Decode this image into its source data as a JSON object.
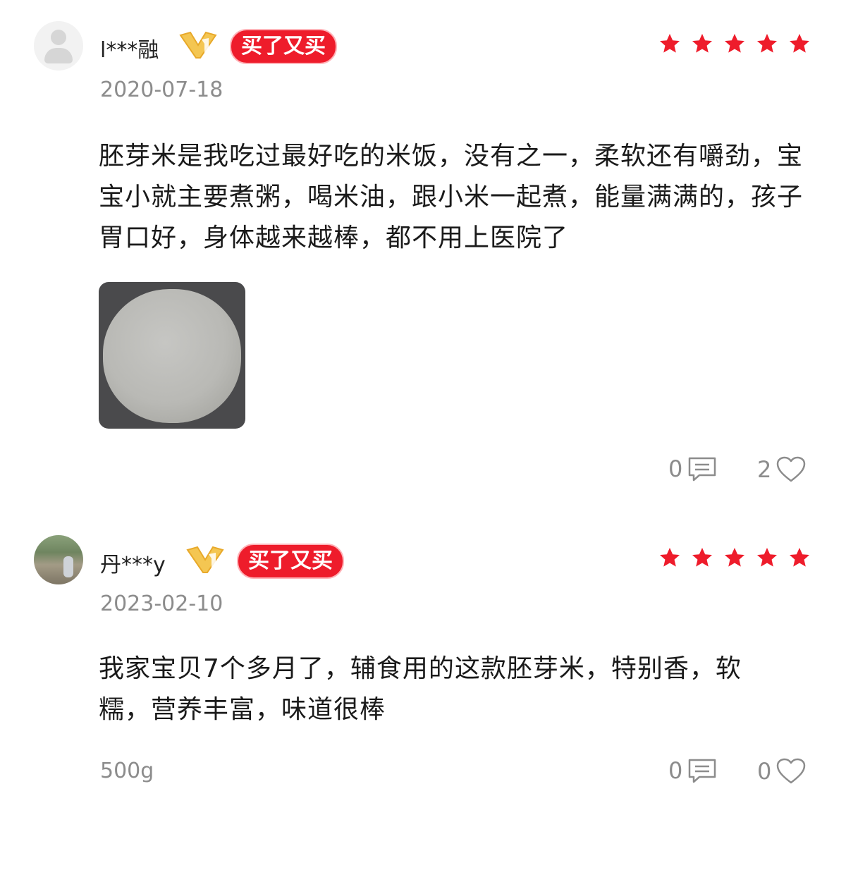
{
  "reviews": [
    {
      "username": "l***融",
      "badge": "买了又买",
      "stars": 5,
      "date": "2020-07-18",
      "text": "胚芽米是我吃过最好吃的米饭，没有之一，柔软还有嚼劲，宝宝小就主要煮粥，喝米油，跟小米一起煮，能量满满的，孩子胃口好，身体越来越棒，都不用上医院了",
      "has_photo": true,
      "comments": "0",
      "likes": "2"
    },
    {
      "username": "丹***y",
      "badge": "买了又买",
      "stars": 5,
      "date": "2023-02-10",
      "text": "我家宝贝7个多月了，辅食用的这款胚芽米，特别香，软糯，营养丰富，味道很棒",
      "spec": "500g",
      "comments": "0",
      "likes": "0"
    }
  ],
  "colors": {
    "star": "#ee1c2b",
    "badge": "#ee1c2b",
    "vip": "#f2c14a"
  },
  "icons": {
    "comment": "comment-icon",
    "like": "heart-icon",
    "vip": "vip-badge-icon",
    "star": "star-icon"
  }
}
